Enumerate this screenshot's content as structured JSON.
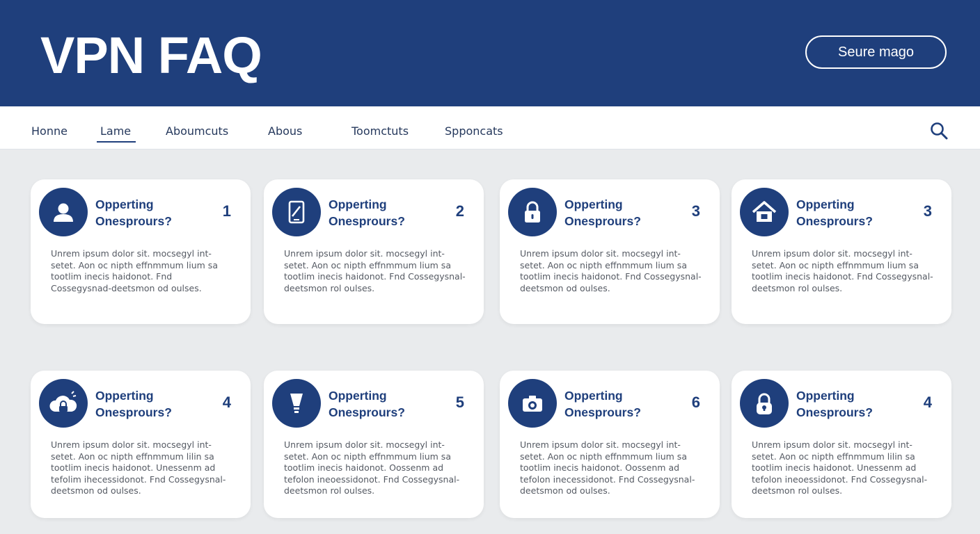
{
  "header": {
    "title": "VPN FAQ",
    "button_label": "Seure mago"
  },
  "nav": {
    "items": [
      {
        "label": "Honne"
      },
      {
        "label": "Lame"
      },
      {
        "label": "Aboumcuts"
      },
      {
        "label": "Abous"
      },
      {
        "label": "Toomctuts"
      },
      {
        "label": "Spponcats"
      }
    ],
    "active": "Lame",
    "search_icon": "search-icon"
  },
  "colors": {
    "header_bg": "#1f3f7c",
    "accent": "#1f3f7c",
    "page_bg": "#e9ebed",
    "card_bg": "#ffffff"
  },
  "cards": [
    {
      "icon": "user-icon",
      "q1": "Opperting",
      "q2": "Onesprours?",
      "num": "1",
      "body": "Unrem ipsum dolor sit. mocsegyl int-setet. Aon oc nipth effnmmum lium sa tootlim inecis haidonot. Fnd Cossegysnad-deetsmon od oulses."
    },
    {
      "icon": "tablet-icon",
      "q1": "Opperting",
      "q2": "Onesprours?",
      "num": "2",
      "body": "Unrem ipsum dolor sit. mocsegyl int-setet. Aon oc nipth effnmmum lium sa tootlim inecis haidonot. Fnd Cossegysnal-deetsmon rol oulses."
    },
    {
      "icon": "lock-icon",
      "q1": "Opperting",
      "q2": "Onesprours?",
      "num": "3",
      "body": "Unrem ipsum dolor sit. mocsegyl int-setet. Aon oc nipth effnmmum lium sa tootlim inecis haidonot. Fnd Cossegysnal-deetsmon od oulses."
    },
    {
      "icon": "home-icon",
      "q1": "Opperting",
      "q2": "Onesprours?",
      "num": "3",
      "body": "Unrem ipsum dolor sit. mocsegyl int-setet. Aon oc nipth effnmmum lium sa tootlim inecis haidonot. Fnd Cossegysnal-deetsmon rol oulses."
    },
    {
      "icon": "cloud-lock-icon",
      "q1": "Opperting",
      "q2": "Onesprours?",
      "num": "4",
      "body": "Unrem ipsum dolor sit. mocsegyl int-setet. Aon oc nipth effnmmum lilin sa tootlim inecis haidonot. Unessenm ad tefolim ihecessidonot. Fnd Cossegysnal-deetsmon od oulses."
    },
    {
      "icon": "lightbulb-icon",
      "q1": "Opperting",
      "q2": "Onesprours?",
      "num": "5",
      "body": "Unrem ipsum dolor sit. mocsegyl int-setet. Aon oc nipth effnmmum lium sa tootlim inecis haidonot. Oossenm ad tefolon ineoessidonot. Fnd Cossegysnal-deetsmon rol oulses."
    },
    {
      "icon": "camera-icon",
      "q1": "Opperting",
      "q2": "Onesprours?",
      "num": "6",
      "body": "Unrem ipsum dolor sit. mocsegyl int-setet. Aon oc nipth effnmmum lium sa tootlim inecis haidonot. Oossenm ad tefolon inecessidonot. Fnd Cossegysnal-deetsmon od oulses."
    },
    {
      "icon": "padlock-icon",
      "q1": "Opperting",
      "q2": "Onesprours?",
      "num": "4",
      "body": "Unrem ipsum dolor sit. mocsegyl int-setet. Aon oc nipth effnmmum lilin sa tootlim inecis haidonot. Unessenm ad tefolon ineoessidonot. Fnd Cossegysnal-deetsmon rol oulses."
    }
  ]
}
